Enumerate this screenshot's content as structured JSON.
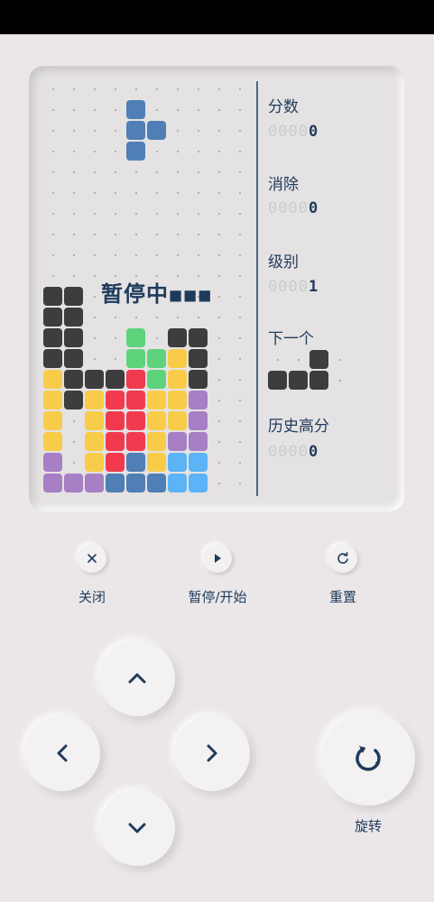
{
  "colors": {
    "dark": "#3d3d3d",
    "blue": "#4f7fb5",
    "green": "#5fd27c",
    "yellow": "#f8cc48",
    "red": "#f23a4f",
    "purple": "#a67fc4",
    "lightblue": "#5cb3f5",
    "accent": "#1f3b5c"
  },
  "board": {
    "cols": 10,
    "rows": 20,
    "paused_text": "暂停中",
    "falling_piece": [
      [
        4,
        1,
        "blue"
      ],
      [
        4,
        2,
        "blue"
      ],
      [
        5,
        2,
        "blue"
      ],
      [
        4,
        3,
        "blue"
      ]
    ],
    "stack": [
      [
        0,
        10,
        "dark"
      ],
      [
        1,
        10,
        "dark"
      ],
      [
        0,
        11,
        "dark"
      ],
      [
        1,
        11,
        "dark"
      ],
      [
        0,
        12,
        "dark"
      ],
      [
        1,
        12,
        "dark"
      ],
      [
        4,
        12,
        "green"
      ],
      [
        6,
        12,
        "dark"
      ],
      [
        7,
        12,
        "dark"
      ],
      [
        0,
        13,
        "dark"
      ],
      [
        1,
        13,
        "dark"
      ],
      [
        4,
        13,
        "green"
      ],
      [
        5,
        13,
        "green"
      ],
      [
        6,
        13,
        "yellow"
      ],
      [
        7,
        13,
        "dark"
      ],
      [
        0,
        14,
        "yellow"
      ],
      [
        1,
        14,
        "dark"
      ],
      [
        2,
        14,
        "dark"
      ],
      [
        3,
        14,
        "dark"
      ],
      [
        4,
        14,
        "red"
      ],
      [
        5,
        14,
        "green"
      ],
      [
        6,
        14,
        "yellow"
      ],
      [
        7,
        14,
        "dark"
      ],
      [
        0,
        15,
        "yellow"
      ],
      [
        1,
        15,
        "dark"
      ],
      [
        2,
        15,
        "yellow"
      ],
      [
        3,
        15,
        "red"
      ],
      [
        4,
        15,
        "red"
      ],
      [
        5,
        15,
        "yellow"
      ],
      [
        6,
        15,
        "yellow"
      ],
      [
        7,
        15,
        "purple"
      ],
      [
        0,
        16,
        "yellow"
      ],
      [
        2,
        16,
        "yellow"
      ],
      [
        3,
        16,
        "red"
      ],
      [
        4,
        16,
        "red"
      ],
      [
        5,
        16,
        "yellow"
      ],
      [
        6,
        16,
        "yellow"
      ],
      [
        7,
        16,
        "purple"
      ],
      [
        0,
        17,
        "yellow"
      ],
      [
        2,
        17,
        "yellow"
      ],
      [
        3,
        17,
        "red"
      ],
      [
        4,
        17,
        "red"
      ],
      [
        5,
        17,
        "yellow"
      ],
      [
        6,
        17,
        "purple"
      ],
      [
        7,
        17,
        "purple"
      ],
      [
        0,
        18,
        "purple"
      ],
      [
        2,
        18,
        "yellow"
      ],
      [
        3,
        18,
        "red"
      ],
      [
        4,
        18,
        "blue"
      ],
      [
        5,
        18,
        "yellow"
      ],
      [
        6,
        18,
        "lightblue"
      ],
      [
        7,
        18,
        "lightblue"
      ],
      [
        0,
        19,
        "purple"
      ],
      [
        1,
        19,
        "purple"
      ],
      [
        2,
        19,
        "purple"
      ],
      [
        3,
        19,
        "blue"
      ],
      [
        4,
        19,
        "blue"
      ],
      [
        5,
        19,
        "blue"
      ],
      [
        6,
        19,
        "lightblue"
      ],
      [
        7,
        19,
        "lightblue"
      ]
    ]
  },
  "info": {
    "score_label": "分数",
    "score_dim": "0000",
    "score_on": "0",
    "lines_label": "消除",
    "lines_dim": "0000",
    "lines_on": "0",
    "level_label": "级别",
    "level_dim": "0000",
    "level_on": "1",
    "next_label": "下一个",
    "next_piece": [
      [
        2,
        0,
        "dark"
      ],
      [
        0,
        1,
        "dark"
      ],
      [
        1,
        1,
        "dark"
      ],
      [
        2,
        1,
        "dark"
      ]
    ],
    "high_label": "历史高分",
    "high_dim": "0000",
    "high_on": "0"
  },
  "controls": {
    "close_label": "关闭",
    "pause_label": "暂停/开始",
    "reset_label": "重置",
    "rotate_label": "旋转"
  },
  "icons": {
    "close": "close-icon",
    "play": "play-icon",
    "reset": "refresh-icon",
    "up": "chevron-up-icon",
    "down": "chevron-down-icon",
    "left": "chevron-left-icon",
    "right": "chevron-right-icon",
    "rotate": "rotate-icon"
  }
}
